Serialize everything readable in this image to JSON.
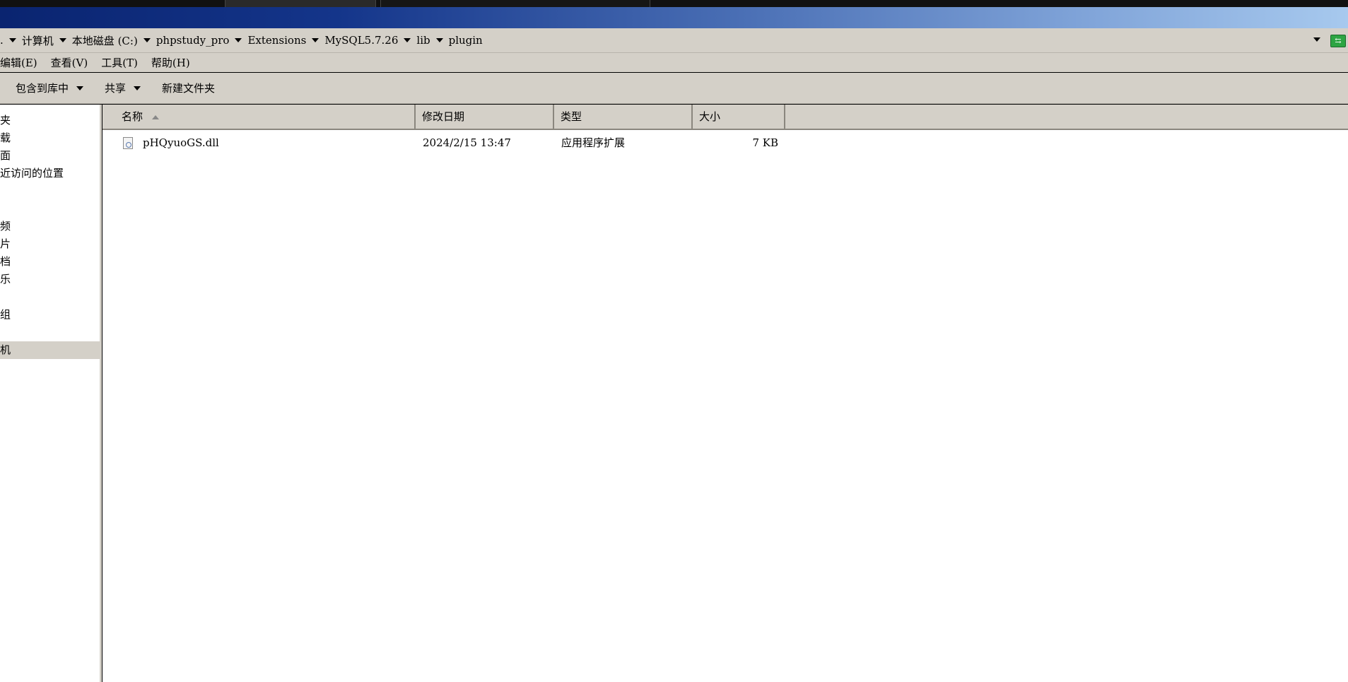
{
  "address_bar": {
    "crumbs": [
      "计算机",
      "本地磁盘 (C:)",
      "phpstudy_pro",
      "Extensions",
      "MySQL5.7.26",
      "lib",
      "plugin"
    ]
  },
  "menu": {
    "items": [
      "编辑(E)",
      "查看(V)",
      "工具(T)",
      "帮助(H)"
    ]
  },
  "toolbar": {
    "include_in_library": "包含到库中",
    "share": "共享",
    "new_folder": "新建文件夹"
  },
  "sidebar": {
    "items": [
      "夹",
      "载",
      "面",
      "近访问的位置",
      "频",
      "片",
      "档",
      "乐",
      "组",
      "机"
    ],
    "selected": "机"
  },
  "columns": {
    "name": "名称",
    "modified": "修改日期",
    "type": "类型",
    "size": "大小"
  },
  "files": [
    {
      "name": "pHQyuoGS.dll",
      "modified": "2024/2/15 13:47",
      "type": "应用程序扩展",
      "size": "7 KB",
      "icon": "dll-file-icon"
    }
  ],
  "colors": {
    "chrome": "#d4d0c8",
    "title_gradient_start": "#0a2470",
    "title_gradient_end": "#a7c9ee"
  }
}
